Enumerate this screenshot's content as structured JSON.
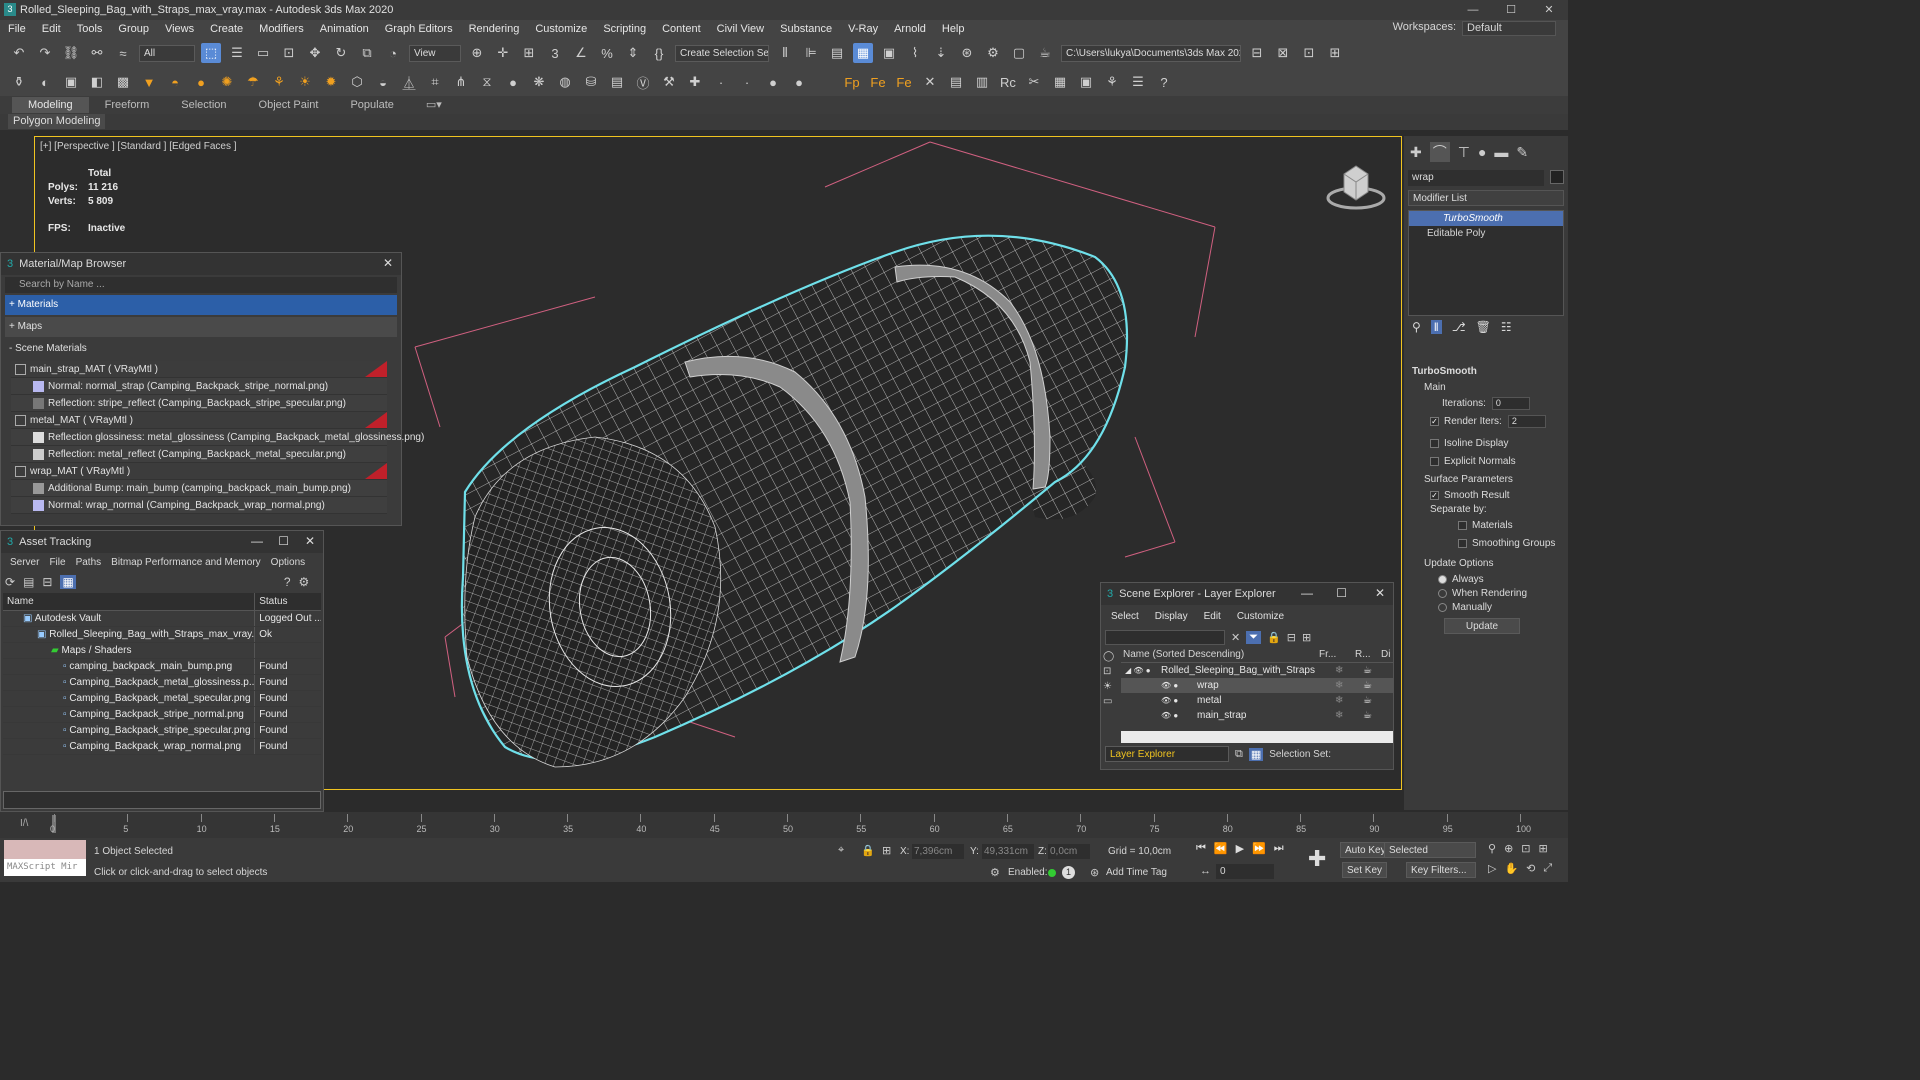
{
  "window": {
    "title": "Rolled_Sleeping_Bag_with_Straps_max_vray.max - Autodesk 3ds Max 2020",
    "min": "—",
    "max": "☐",
    "close": "✕"
  },
  "menu": [
    "File",
    "Edit",
    "Tools",
    "Group",
    "Views",
    "Create",
    "Modifiers",
    "Animation",
    "Graph Editors",
    "Rendering",
    "Customize",
    "Scripting",
    "Content",
    "Civil View",
    "Substance",
    "V-Ray",
    "Arnold",
    "Help"
  ],
  "workspace": {
    "label": "Workspaces:",
    "value": "Default"
  },
  "toolbar": {
    "filter": "All",
    "ref_coord": "View",
    "selection_set": "Create Selection Se",
    "path": "C:\\Users\\lukya\\Documents\\3ds Max 2022"
  },
  "ribbon": {
    "tabs": [
      "Modeling",
      "Freeform",
      "Selection",
      "Object Paint",
      "Populate"
    ],
    "sub": "Polygon Modeling"
  },
  "viewport": {
    "label": "[+] [Perspective ] [Standard ] [Edged Faces ]",
    "stats_header": "Total",
    "polys_label": "Polys:",
    "polys": "11 216",
    "verts_label": "Verts:",
    "verts": "5 809",
    "fps_label": "FPS:",
    "fps": "Inactive"
  },
  "mat_browser": {
    "title": "Material/Map Browser",
    "search": "Search by Name ...",
    "groups": [
      "+ Materials",
      "+ Maps",
      "- Scene Materials"
    ],
    "rows": [
      {
        "text": "main_strap_MAT  ( VRayMtl )",
        "mat": true,
        "color": "#3c3c3c"
      },
      {
        "text": "Normal: normal_strap (Camping_Backpack_stripe_normal.png)",
        "mat": false,
        "color": "#b8b8f0"
      },
      {
        "text": "Reflection: stripe_reflect (Camping_Backpack_stripe_specular.png)",
        "mat": false,
        "color": "#777777"
      },
      {
        "text": "metal_MAT  ( VRayMtl )",
        "mat": true,
        "color": "#3c3c3c"
      },
      {
        "text": "Reflection glossiness: metal_glossiness (Camping_Backpack_metal_glossiness.png)",
        "mat": false,
        "color": "#dddddd"
      },
      {
        "text": "Reflection: metal_reflect (Camping_Backpack_metal_specular.png)",
        "mat": false,
        "color": "#cccccc"
      },
      {
        "text": "wrap_MAT  ( VRayMtl )",
        "mat": true,
        "color": "#3c3c3c"
      },
      {
        "text": "Additional Bump: main_bump (camping_backpack_main_bump.png)",
        "mat": false,
        "color": "#999999"
      },
      {
        "text": "Normal: wrap_normal (Camping_Backpack_wrap_normal.png)",
        "mat": false,
        "color": "#b8b8f0"
      }
    ]
  },
  "asset": {
    "title": "Asset Tracking",
    "menu": [
      "Server",
      "File",
      "Paths",
      "Bitmap Performance and Memory",
      "Options"
    ],
    "col_name": "Name",
    "col_status": "Status",
    "rows": [
      {
        "name": "Autodesk Vault",
        "status": "Logged Out ...",
        "indent": 20
      },
      {
        "name": "Rolled_Sleeping_Bag_with_Straps_max_vray.m...",
        "status": "Ok",
        "indent": 34
      },
      {
        "name": "Maps / Shaders",
        "status": "",
        "indent": 48
      },
      {
        "name": "camping_backpack_main_bump.png",
        "status": "Found",
        "indent": 60
      },
      {
        "name": "Camping_Backpack_metal_glossiness.p...",
        "status": "Found",
        "indent": 60
      },
      {
        "name": "Camping_Backpack_metal_specular.png",
        "status": "Found",
        "indent": 60
      },
      {
        "name": "Camping_Backpack_stripe_normal.png",
        "status": "Found",
        "indent": 60
      },
      {
        "name": "Camping_Backpack_stripe_specular.png",
        "status": "Found",
        "indent": 60
      },
      {
        "name": "Camping_Backpack_wrap_normal.png",
        "status": "Found",
        "indent": 60
      }
    ]
  },
  "scene_exp": {
    "title": "Scene Explorer - Layer Explorer",
    "menu": [
      "Select",
      "Display",
      "Edit",
      "Customize"
    ],
    "col_name": "Name (Sorted Descending)",
    "col_fr": "Fr...",
    "col_r": "R...",
    "col_d": "Di",
    "rows": [
      {
        "name": "Rolled_Sleeping_Bag_with_Straps",
        "indent": 40
      },
      {
        "name": "wrap",
        "indent": 76
      },
      {
        "name": "metal",
        "indent": 76
      },
      {
        "name": "main_strap",
        "indent": 76
      }
    ],
    "layer": "Layer Explorer",
    "selset": "Selection Set:"
  },
  "cmd": {
    "object_name": "wrap",
    "modifier_list": "Modifier List",
    "stack": [
      "TurboSmooth",
      "Editable Poly"
    ],
    "ts_title": "TurboSmooth",
    "main": "Main",
    "iter_label": "Iterations:",
    "iter": "0",
    "render_label": "Render Iters:",
    "render": "2",
    "isoline": "Isoline Display",
    "explicit": "Explicit Normals",
    "surf": "Surface Parameters",
    "smooth": "Smooth Result",
    "sep": "Separate by:",
    "materials": "Materials",
    "sgroups": "Smoothing Groups",
    "update_opts": "Update Options",
    "always": "Always",
    "when": "When Rendering",
    "manually": "Manually",
    "update": "Update"
  },
  "timeline": {
    "ticks": [
      "0",
      "5",
      "10",
      "15",
      "20",
      "25",
      "30",
      "35",
      "40",
      "45",
      "50",
      "55",
      "60",
      "65",
      "70",
      "75",
      "80",
      "85",
      "90",
      "95",
      "100"
    ]
  },
  "status": {
    "maxscript": "MAXScript Mir",
    "selected": "1 Object Selected",
    "hint": "Click or click-and-drag to select objects",
    "x_label": "X:",
    "x": "7,396cm",
    "y_label": "Y:",
    "y": "49,331cm",
    "z_label": "Z:",
    "z": "0,0cm",
    "grid": "Grid = 10,0cm",
    "enabled": "Enabled:",
    "addtag": "Add Time Tag",
    "autokey": "Auto Key",
    "setkey": "Set Key",
    "sel_mode": "Selected",
    "frame": "0",
    "keyfilters": "Key Filters..."
  }
}
